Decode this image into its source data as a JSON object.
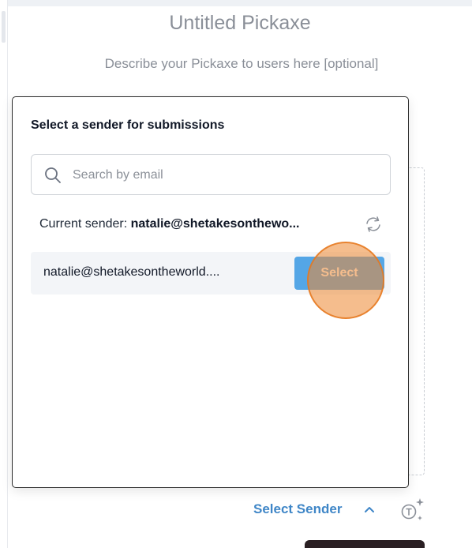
{
  "page": {
    "title": "Untitled Pickaxe",
    "description": "Describe your Pickaxe to users here [optional]"
  },
  "modal": {
    "heading": "Select a sender for submissions",
    "search": {
      "placeholder": "Search by email",
      "value": ""
    },
    "current_sender_label": "Current sender: ",
    "current_sender_value": "natalie@shetakesonthewo...",
    "senders": [
      {
        "email": "natalie@shetakesontheworld....",
        "action_label": "Select"
      }
    ]
  },
  "footer": {
    "select_sender_label": "Select Sender"
  },
  "icons": {
    "search": "search-icon",
    "refresh": "refresh-icon",
    "chevron": "chevron-up-icon",
    "ai": "ai-sparkle-icon"
  },
  "colors": {
    "accent_blue": "#3f86c7",
    "button_blue": "#54a6e6",
    "click_highlight": "#ec8730",
    "dark_button": "#2a1f23"
  }
}
